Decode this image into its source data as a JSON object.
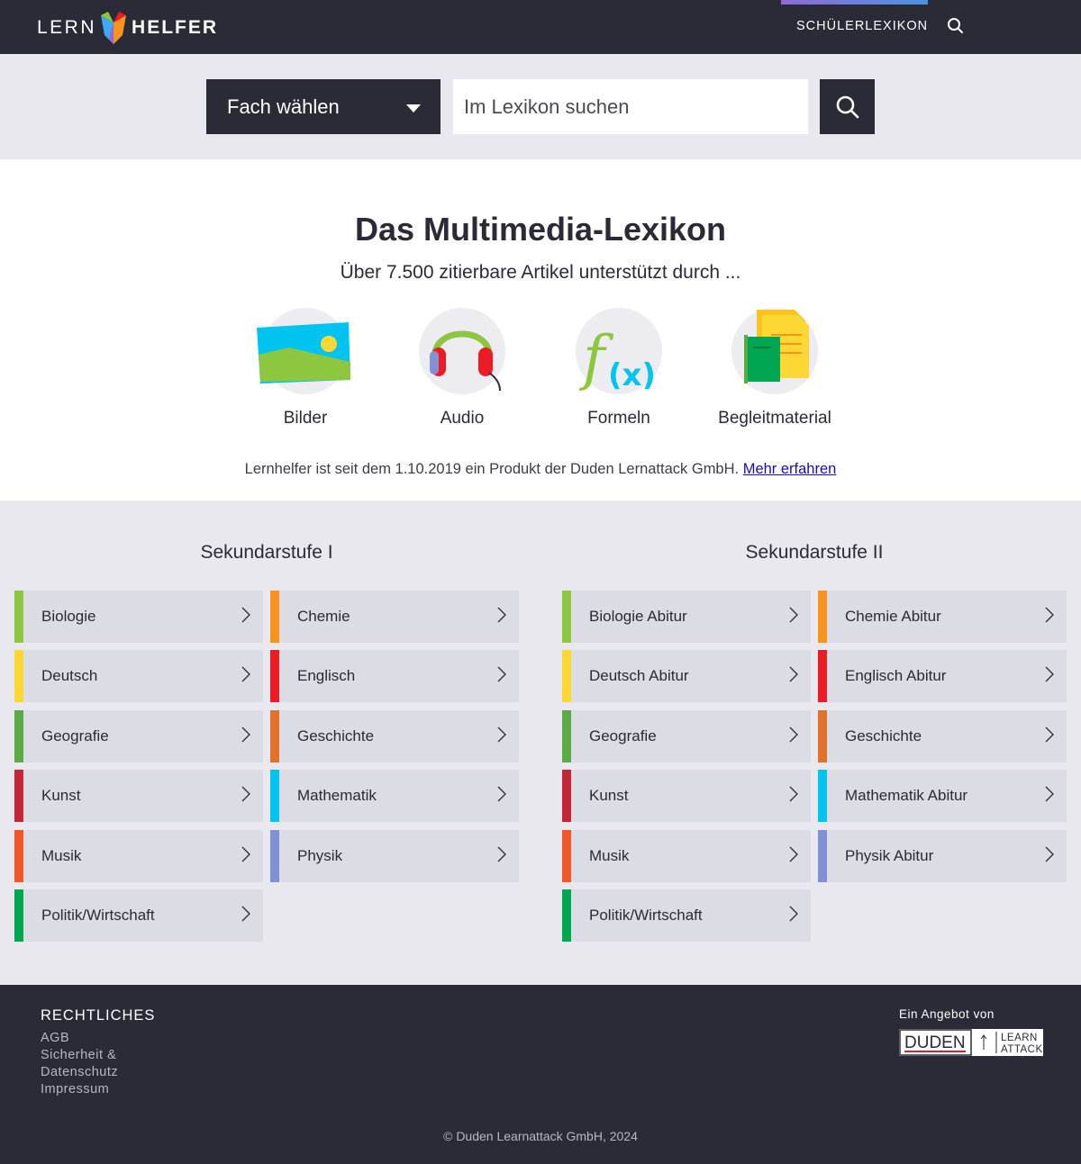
{
  "header": {
    "logo_left": "LERN",
    "logo_right": "HELFER",
    "nav_link": "SCHÜLERLEXIKON"
  },
  "search": {
    "subject_select": "Fach wählen",
    "placeholder": "Im Lexikon suchen"
  },
  "hero": {
    "title": "Das Multimedia-Lexikon",
    "subtitle": "Über 7.500 zitierbare Artikel unterstützt durch ...",
    "features": [
      {
        "label": "Bilder",
        "icon": "images-icon"
      },
      {
        "label": "Audio",
        "icon": "headphones-icon"
      },
      {
        "label": "Formeln",
        "icon": "formula-icon"
      },
      {
        "label": "Begleitmaterial",
        "icon": "documents-icon"
      }
    ],
    "notice_text": "Lernhelfer ist seit dem 1.10.2019 ein Produkt der Duden Lernattack GmbH. ",
    "notice_link": "Mehr erfahren"
  },
  "subjects": {
    "sek1": {
      "title": "Sekundarstufe I",
      "items": [
        {
          "name": "Biologie",
          "color": "#8dc63f"
        },
        {
          "name": "Chemie",
          "color": "#f7941d"
        },
        {
          "name": "Deutsch",
          "color": "#fdd835"
        },
        {
          "name": "Englisch",
          "color": "#ed1c24"
        },
        {
          "name": "Geografie",
          "color": "#5aaa46"
        },
        {
          "name": "Geschichte",
          "color": "#e2722b"
        },
        {
          "name": "Kunst",
          "color": "#c52637"
        },
        {
          "name": "Mathematik",
          "color": "#00c4f0"
        },
        {
          "name": "Musik",
          "color": "#f0582a"
        },
        {
          "name": "Physik",
          "color": "#8091d5"
        },
        {
          "name": "Politik/Wirtschaft",
          "color": "#00a651"
        }
      ]
    },
    "sek2": {
      "title": "Sekundarstufe II",
      "items": [
        {
          "name": "Biologie Abitur",
          "color": "#8dc63f"
        },
        {
          "name": "Chemie Abitur",
          "color": "#f7941d"
        },
        {
          "name": "Deutsch Abitur",
          "color": "#fdd835"
        },
        {
          "name": "Englisch Abitur",
          "color": "#ed1c24"
        },
        {
          "name": "Geografie",
          "color": "#5aaa46"
        },
        {
          "name": "Geschichte",
          "color": "#e2722b"
        },
        {
          "name": "Kunst",
          "color": "#c52637"
        },
        {
          "name": "Mathematik Abitur",
          "color": "#00c4f0"
        },
        {
          "name": "Musik",
          "color": "#f0582a"
        },
        {
          "name": "Physik Abitur",
          "color": "#8091d5"
        },
        {
          "name": "Politik/Wirtschaft",
          "color": "#00a651"
        }
      ]
    }
  },
  "footer": {
    "legal_title": "RECHTLICHES",
    "links": [
      "AGB",
      "Sicherheit &",
      "Datenschutz",
      "Impressum"
    ],
    "offer_text": "Ein Angebot von",
    "partner_duden": "DUDEN",
    "partner_learn": "LEARN",
    "partner_attack": "ATTACK",
    "copyright": "© Duden Learnattack GmbH, 2024"
  }
}
